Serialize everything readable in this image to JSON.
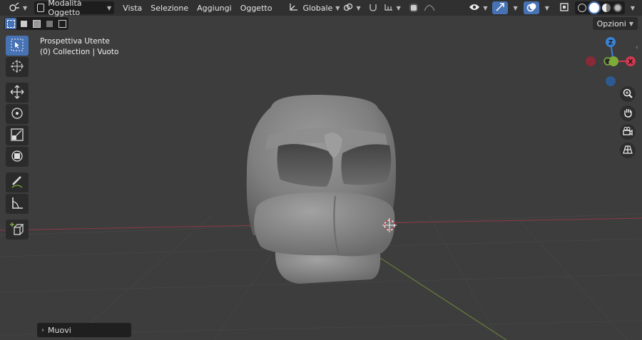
{
  "header": {
    "mode_label": "Modalità Oggetto",
    "menus": [
      "Vista",
      "Selezione",
      "Aggiungi",
      "Oggetto"
    ],
    "transform_orientation": "Globale"
  },
  "options_label": "Opzioni",
  "overlay_info": {
    "view_name": "Prospettiva Utente",
    "collection": "(0) Collection | Vuoto"
  },
  "gizmo": {
    "z": "Z",
    "y": "Y",
    "x": "X"
  },
  "last_operator_panel": {
    "label": "Muovi"
  },
  "colors": {
    "accent": "#4772b3",
    "background": "#3d3d3d",
    "header": "#303030",
    "x_axis": "#d1384f",
    "y_axis": "#7dac3a",
    "z_axis": "#3a82d6"
  }
}
